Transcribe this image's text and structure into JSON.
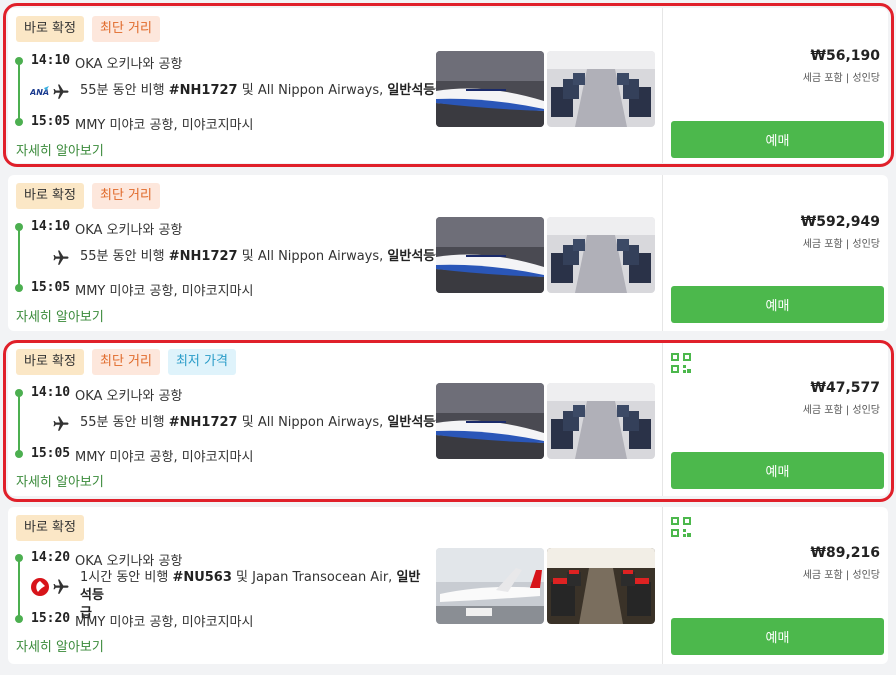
{
  "results": [
    {
      "tags": [
        "바로 확정",
        "최단 거리"
      ],
      "depart_time": "14:10",
      "depart_airport": "OKA 오키나와 공항",
      "seg_prefix": "55분 동안 비행 ",
      "flight_no": "#NH1727",
      "seg_mid": " 및 All Nippon Airways, ",
      "cabin": "일반석등급",
      "arrive_time": "15:05",
      "arrive_airport": "MMY 미야코 공항, 미야코지마시",
      "more": "자세히 알아보기",
      "price": "₩56,190",
      "price_note": "세금 포함 | 성인당",
      "book": "예매"
    },
    {
      "tags": [
        "바로 확정",
        "최단 거리"
      ],
      "depart_time": "14:10",
      "depart_airport": "OKA 오키나와 공항",
      "seg_prefix": "55분 동안 비행 ",
      "flight_no": "#NH1727",
      "seg_mid": " 및 All Nippon Airways, ",
      "cabin": "일반석등급",
      "arrive_time": "15:05",
      "arrive_airport": "MMY 미야코 공항, 미야코지마시",
      "more": "자세히 알아보기",
      "price": "₩592,949",
      "price_note": "세금 포함 | 성인당",
      "book": "예매"
    },
    {
      "tags": [
        "바로 확정",
        "최단 거리",
        "최저 가격"
      ],
      "depart_time": "14:10",
      "depart_airport": "OKA 오키나와 공항",
      "seg_prefix": "55분 동안 비행 ",
      "flight_no": "#NH1727",
      "seg_mid": " 및 All Nippon Airways, ",
      "cabin": "일반석등급",
      "arrive_time": "15:05",
      "arrive_airport": "MMY 미야코 공항, 미야코지마시",
      "more": "자세히 알아보기",
      "price": "₩47,577",
      "price_note": "세금 포함 | 성인당",
      "book": "예매"
    },
    {
      "tags": [
        "바로 확정"
      ],
      "depart_time": "14:20",
      "depart_airport": "OKA 오키나와 공항",
      "seg_prefix": "1시간 동안 비행 ",
      "flight_no": "#NU563",
      "seg_mid": " 및 Japan Transocean Air, ",
      "cabin": "일반석등",
      "cabin_wrap": "급",
      "arrive_time": "15:20",
      "arrive_airport": "MMY 미야코 공항, 미야코지마시",
      "more": "자세히 알아보기",
      "price": "₩89,216",
      "price_note": "세금 포함 | 성인당",
      "book": "예매"
    }
  ],
  "colors": {
    "accent": "#4cb84c",
    "highlight": "#e0202a"
  }
}
